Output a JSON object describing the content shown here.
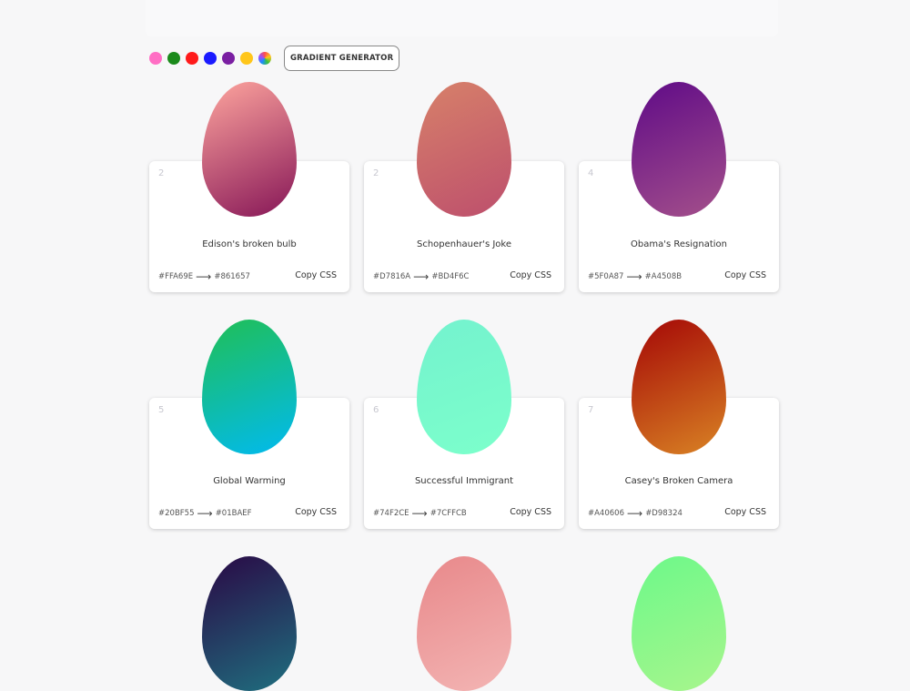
{
  "header": {
    "color_filters": [
      {
        "name": "pink",
        "color": "#ff6ec4"
      },
      {
        "name": "green",
        "color": "#1b8a1b"
      },
      {
        "name": "red",
        "color": "#ff1a1a"
      },
      {
        "name": "blue",
        "color": "#1a1aff"
      },
      {
        "name": "purple",
        "color": "#7a1fa2"
      },
      {
        "name": "yellow",
        "color": "#ffc61a"
      }
    ],
    "generator_label": "GRADIENT GENERATOR"
  },
  "copy_label": "Copy CSS",
  "gradients": [
    {
      "num": "2",
      "name": "Edison's broken bulb",
      "from": "#FFA69E",
      "to": "#861657"
    },
    {
      "num": "2",
      "name": "Schopenhauer's Joke",
      "from": "#D7816A",
      "to": "#BD4F6C"
    },
    {
      "num": "4",
      "name": "Obama's Resignation",
      "from": "#5F0A87",
      "to": "#A4508B"
    },
    {
      "num": "5",
      "name": "Global Warming",
      "from": "#20BF55",
      "to": "#01BAEF"
    },
    {
      "num": "6",
      "name": "Successful Immigrant",
      "from": "#74F2CE",
      "to": "#7CFFCB"
    },
    {
      "num": "7",
      "name": "Casey's Broken Camera",
      "from": "#A40606",
      "to": "#D98324"
    },
    {
      "num": "",
      "name": "",
      "from": "#2a0845",
      "to": "#1f6f7f"
    },
    {
      "num": "",
      "name": "",
      "from": "#e8888a",
      "to": "#f3b5b4"
    },
    {
      "num": "",
      "name": "",
      "from": "#6cf98a",
      "to": "#a8f58c"
    }
  ]
}
